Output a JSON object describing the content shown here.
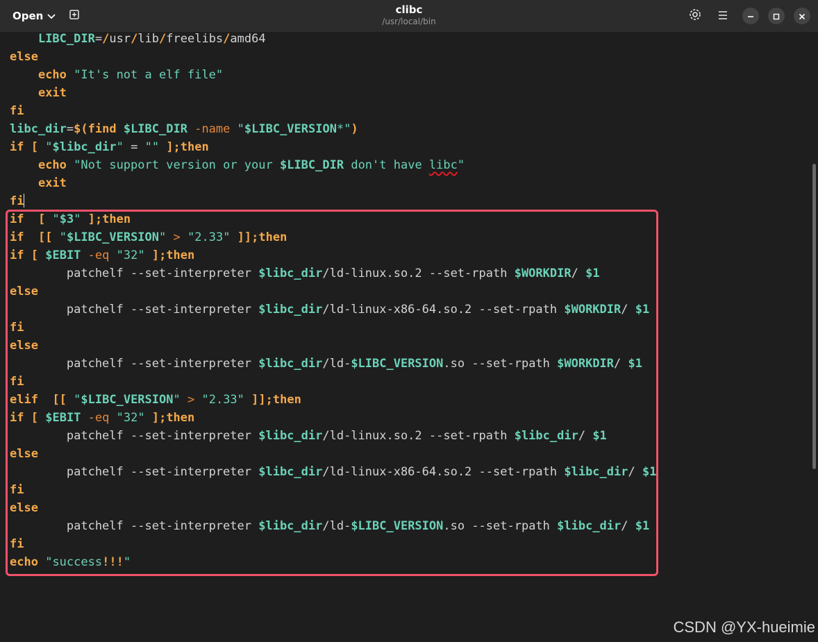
{
  "header": {
    "open_label": "Open",
    "title": "clibc",
    "subtitle": "/usr/local/bin"
  },
  "icons": {
    "open_dropdown": "chevron-down-icon",
    "new_tab": "new-tab-icon",
    "settings": "gear-icon",
    "menu": "hamburger-menu-icon",
    "minimize": "minimize-icon",
    "maximize": "maximize-icon",
    "close": "close-icon"
  },
  "editor": {
    "code_lines": [
      [
        {
          "t": "    "
        },
        {
          "t": "LIBC_DIR",
          "c": "var"
        },
        {
          "t": "="
        },
        {
          "t": "/",
          "c": "op"
        },
        {
          "t": "usr"
        },
        {
          "t": "/",
          "c": "op"
        },
        {
          "t": "lib"
        },
        {
          "t": "/",
          "c": "op"
        },
        {
          "t": "freelibs"
        },
        {
          "t": "/",
          "c": "op"
        },
        {
          "t": "amd64"
        }
      ],
      [
        {
          "t": "else",
          "c": "kw"
        }
      ],
      [
        {
          "t": "    "
        },
        {
          "t": "echo",
          "c": "kw"
        },
        {
          "t": " "
        },
        {
          "t": "\"It's not a elf file\"",
          "c": "str"
        }
      ],
      [
        {
          "t": "    "
        },
        {
          "t": "exit",
          "c": "kw"
        }
      ],
      [
        {
          "t": "fi",
          "c": "kw"
        }
      ],
      [
        {
          "t": "libc_dir",
          "c": "var"
        },
        {
          "t": "=",
          "c": "plain"
        },
        {
          "t": "$(",
          "c": "op"
        },
        {
          "t": "find",
          "c": "kw"
        },
        {
          "t": " "
        },
        {
          "t": "$LIBC_DIR",
          "c": "var"
        },
        {
          "t": " "
        },
        {
          "t": "-name",
          "c": "opt"
        },
        {
          "t": " "
        },
        {
          "t": "\"",
          "c": "str"
        },
        {
          "t": "$LIBC_VERSION",
          "c": "var"
        },
        {
          "t": "*\"",
          "c": "str"
        },
        {
          "t": ")",
          "c": "op"
        }
      ],
      [
        {
          "t": "if",
          "c": "kw"
        },
        {
          "t": " "
        },
        {
          "t": "[",
          "c": "op"
        },
        {
          "t": " "
        },
        {
          "t": "\"",
          "c": "str"
        },
        {
          "t": "$libc_dir",
          "c": "var"
        },
        {
          "t": "\"",
          "c": "str"
        },
        {
          "t": " = "
        },
        {
          "t": "\"\"",
          "c": "str"
        },
        {
          "t": " "
        },
        {
          "t": "];then",
          "c": "op"
        }
      ],
      [
        {
          "t": "    "
        },
        {
          "t": "echo",
          "c": "kw"
        },
        {
          "t": " "
        },
        {
          "t": "\"Not support version or your ",
          "c": "str"
        },
        {
          "t": "$LIBC_DIR",
          "c": "var"
        },
        {
          "t": " don't have ",
          "c": "str"
        },
        {
          "t": "libc",
          "c": "str spell"
        },
        {
          "t": "\"",
          "c": "str"
        }
      ],
      [
        {
          "t": "    "
        },
        {
          "t": "exit",
          "c": "kw"
        }
      ],
      [
        {
          "t": "fi",
          "c": "kw"
        },
        {
          "caret": true
        }
      ],
      [
        {
          "t": "if",
          "c": "kw"
        },
        {
          "t": "  "
        },
        {
          "t": "[",
          "c": "op"
        },
        {
          "t": " "
        },
        {
          "t": "\"",
          "c": "str"
        },
        {
          "t": "$3",
          "c": "var"
        },
        {
          "t": "\"",
          "c": "str"
        },
        {
          "t": " "
        },
        {
          "t": "];then",
          "c": "op"
        }
      ],
      [
        {
          "t": "if",
          "c": "kw"
        },
        {
          "t": "  "
        },
        {
          "t": "[[",
          "c": "op"
        },
        {
          "t": " "
        },
        {
          "t": "\"",
          "c": "str"
        },
        {
          "t": "$LIBC_VERSION",
          "c": "var"
        },
        {
          "t": "\"",
          "c": "str"
        },
        {
          "t": " "
        },
        {
          "t": ">",
          "c": "opt"
        },
        {
          "t": " "
        },
        {
          "t": "\"2.33\"",
          "c": "str"
        },
        {
          "t": " "
        },
        {
          "t": "]];then",
          "c": "op"
        }
      ],
      [
        {
          "t": "if",
          "c": "kw"
        },
        {
          "t": " "
        },
        {
          "t": "[",
          "c": "op"
        },
        {
          "t": " "
        },
        {
          "t": "$EBIT",
          "c": "var"
        },
        {
          "t": " "
        },
        {
          "t": "-eq",
          "c": "opt"
        },
        {
          "t": " "
        },
        {
          "t": "\"32\"",
          "c": "str"
        },
        {
          "t": " "
        },
        {
          "t": "];then",
          "c": "op"
        }
      ],
      [
        {
          "t": "        patchelf --set-interpreter "
        },
        {
          "t": "$libc_dir",
          "c": "var"
        },
        {
          "t": "/ld-linux.so.2 --set-rpath "
        },
        {
          "t": "$WORKDIR",
          "c": "var"
        },
        {
          "t": "/ "
        },
        {
          "t": "$1",
          "c": "var"
        }
      ],
      [
        {
          "t": "else",
          "c": "kw"
        }
      ],
      [
        {
          "t": "        patchelf --set-interpreter "
        },
        {
          "t": "$libc_dir",
          "c": "var"
        },
        {
          "t": "/ld-linux-x86-64.so.2 --set-rpath "
        },
        {
          "t": "$WORKDIR",
          "c": "var"
        },
        {
          "t": "/ "
        },
        {
          "t": "$1",
          "c": "var"
        }
      ],
      [
        {
          "t": "fi",
          "c": "kw"
        }
      ],
      [
        {
          "t": "else",
          "c": "kw"
        }
      ],
      [
        {
          "t": "        patchelf --set-interpreter "
        },
        {
          "t": "$libc_dir",
          "c": "var"
        },
        {
          "t": "/ld-"
        },
        {
          "t": "$LIBC_VERSION",
          "c": "var"
        },
        {
          "t": ".so --set-rpath "
        },
        {
          "t": "$WORKDIR",
          "c": "var"
        },
        {
          "t": "/ "
        },
        {
          "t": "$1",
          "c": "var"
        }
      ],
      [
        {
          "t": "fi",
          "c": "kw"
        }
      ],
      [
        {
          "t": "elif",
          "c": "kw"
        },
        {
          "t": "  "
        },
        {
          "t": "[[",
          "c": "op"
        },
        {
          "t": " "
        },
        {
          "t": "\"",
          "c": "str"
        },
        {
          "t": "$LIBC_VERSION",
          "c": "var"
        },
        {
          "t": "\"",
          "c": "str"
        },
        {
          "t": " "
        },
        {
          "t": ">",
          "c": "opt"
        },
        {
          "t": " "
        },
        {
          "t": "\"2.33\"",
          "c": "str"
        },
        {
          "t": " "
        },
        {
          "t": "]];then",
          "c": "op"
        }
      ],
      [
        {
          "t": "if",
          "c": "kw"
        },
        {
          "t": " "
        },
        {
          "t": "[",
          "c": "op"
        },
        {
          "t": " "
        },
        {
          "t": "$EBIT",
          "c": "var"
        },
        {
          "t": " "
        },
        {
          "t": "-eq",
          "c": "opt"
        },
        {
          "t": " "
        },
        {
          "t": "\"32\"",
          "c": "str"
        },
        {
          "t": " "
        },
        {
          "t": "];then",
          "c": "op"
        }
      ],
      [
        {
          "t": "        patchelf --set-interpreter "
        },
        {
          "t": "$libc_dir",
          "c": "var"
        },
        {
          "t": "/ld-linux.so.2 --set-rpath "
        },
        {
          "t": "$libc_dir",
          "c": "var"
        },
        {
          "t": "/ "
        },
        {
          "t": "$1",
          "c": "var"
        }
      ],
      [
        {
          "t": "else",
          "c": "kw"
        }
      ],
      [
        {
          "t": "        patchelf --set-interpreter "
        },
        {
          "t": "$libc_dir",
          "c": "var"
        },
        {
          "t": "/ld-linux-x86-64.so.2 --set-rpath "
        },
        {
          "t": "$libc_dir",
          "c": "var"
        },
        {
          "t": "/ "
        },
        {
          "t": "$1",
          "c": "var"
        }
      ],
      [
        {
          "t": "fi",
          "c": "kw"
        }
      ],
      [
        {
          "t": "else",
          "c": "kw"
        }
      ],
      [
        {
          "t": "        patchelf --set-interpreter "
        },
        {
          "t": "$libc_dir",
          "c": "var"
        },
        {
          "t": "/ld-"
        },
        {
          "t": "$LIBC_VERSION",
          "c": "var"
        },
        {
          "t": ".so --set-rpath "
        },
        {
          "t": "$libc_dir",
          "c": "var"
        },
        {
          "t": "/ "
        },
        {
          "t": "$1",
          "c": "var"
        }
      ],
      [
        {
          "t": "fi",
          "c": "kw"
        }
      ],
      [
        {
          "t": "echo",
          "c": "kw"
        },
        {
          "t": " "
        },
        {
          "t": "\"success",
          "c": "str"
        },
        {
          "t": "!!!",
          "c": "op"
        },
        {
          "t": "\"",
          "c": "str"
        }
      ]
    ]
  },
  "watermark": "CSDN @YX-hueimie",
  "colors": {
    "keyword": "#f5a94b",
    "variable": "#6cd2b8",
    "option": "#e5863a",
    "highlight_border": "#f0526a"
  }
}
